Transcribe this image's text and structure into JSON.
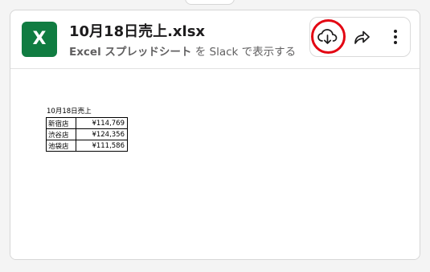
{
  "file": {
    "icon_letter": "X",
    "name": "10月18日売上.xlsx",
    "subtitle_bold": "Excel スプレッドシート",
    "subtitle_rest": " を Slack で表示する"
  },
  "actions": {
    "download": "cloud-download-icon",
    "share": "share-arrow-icon",
    "more": "more-vertical-icon"
  },
  "highlight_color": "#e30613",
  "brand_color": "#107c41",
  "sheet": {
    "title": "10月18日売上",
    "rows": [
      {
        "store": "新宿店",
        "amount": "¥114,769"
      },
      {
        "store": "渋谷店",
        "amount": "¥124,356"
      },
      {
        "store": "池袋店",
        "amount": "¥111,586"
      }
    ]
  }
}
